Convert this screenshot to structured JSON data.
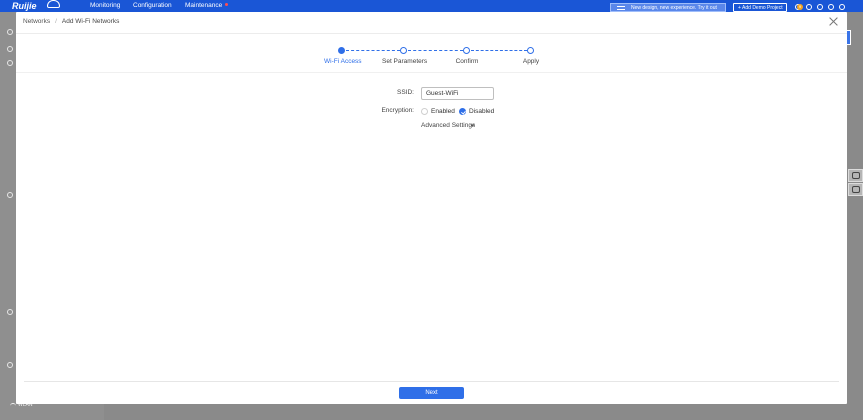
{
  "topbar": {
    "logo": "Ruijie",
    "nav": [
      "Monitoring",
      "Configuration",
      "Maintenance"
    ],
    "banner": "New design, new experience. Try it out",
    "demo_button": "+ Add Demo Project",
    "notification_count": "9"
  },
  "sidebar": {
    "bottom_item": "WLAN"
  },
  "modal": {
    "breadcrumb": {
      "parent": "Networks",
      "separator": "/",
      "current": "Add Wi-Fi Networks"
    },
    "steps": [
      {
        "label": "Wi-Fi Access",
        "state": "active"
      },
      {
        "label": "Set Parameters",
        "state": "pending"
      },
      {
        "label": "Confirm",
        "state": "pending"
      },
      {
        "label": "Apply",
        "state": "pending"
      }
    ],
    "form": {
      "ssid_label": "SSID:",
      "ssid_value": "Guest-WiFi",
      "encryption_label": "Encryption:",
      "encryption_options": [
        "Enabled",
        "Disabled"
      ],
      "encryption_selected": "Disabled",
      "advanced_settings": "Advanced Settings"
    },
    "next_button": "Next"
  },
  "colors": {
    "primary": "#2f6fe8",
    "topbar": "#1a56d6",
    "overlay": "#8a8a8a"
  }
}
